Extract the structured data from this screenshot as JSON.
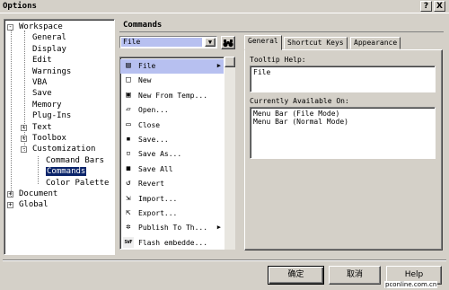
{
  "window": {
    "title": "Options",
    "help_button": "?",
    "close_button": "X"
  },
  "tree": {
    "items": [
      {
        "label": "Workspace",
        "expander": "-"
      },
      {
        "label": "General"
      },
      {
        "label": "Display"
      },
      {
        "label": "Edit"
      },
      {
        "label": "Warnings"
      },
      {
        "label": "VBA"
      },
      {
        "label": "Save"
      },
      {
        "label": "Memory"
      },
      {
        "label": "Plug-Ins"
      },
      {
        "label": "Text",
        "expander": "+"
      },
      {
        "label": "Toolbox",
        "expander": "+"
      },
      {
        "label": "Customization",
        "expander": "-"
      },
      {
        "label": "Command Bars"
      },
      {
        "label": "Commands",
        "selected": true
      },
      {
        "label": "Color Palette"
      },
      {
        "label": "Document",
        "expander": "+"
      },
      {
        "label": "Global",
        "expander": "+"
      }
    ]
  },
  "main": {
    "header": "Commands",
    "category_dropdown": {
      "value": "File",
      "arrow": "▼"
    },
    "find_button_icon": "binoculars-icon",
    "commands": [
      {
        "label": "File",
        "icon": "file-icon",
        "submenu": "▶",
        "selected": true
      },
      {
        "label": "New",
        "icon": "new-document-icon"
      },
      {
        "label": "New From Temp...",
        "icon": "new-from-template-icon"
      },
      {
        "label": "Open...",
        "icon": "open-folder-icon"
      },
      {
        "label": "Close",
        "icon": "close-document-icon"
      },
      {
        "label": "Save...",
        "icon": "save-icon"
      },
      {
        "label": "Save As...",
        "icon": "save-as-icon"
      },
      {
        "label": "Save All",
        "icon": "save-all-icon"
      },
      {
        "label": "Revert",
        "icon": "revert-icon"
      },
      {
        "label": "Import...",
        "icon": "import-icon"
      },
      {
        "label": "Export...",
        "icon": "export-icon"
      },
      {
        "label": "Publish To Th...",
        "icon": "publish-icon",
        "submenu": "▶"
      },
      {
        "label": "Flash embedde...",
        "icon": "swf-icon",
        "icon_text": "SWF"
      }
    ]
  },
  "tabs": [
    {
      "label": "General",
      "active": true
    },
    {
      "label": "Shortcut Keys"
    },
    {
      "label": "Appearance"
    }
  ],
  "general_tab": {
    "tooltip_label": "Tooltip Help:",
    "tooltip_value": "File",
    "available_label": "Currently Available On:",
    "available_value": "Menu Bar (File Mode)\nMenu Bar (Normal Mode)"
  },
  "buttons": {
    "ok": "确定",
    "cancel": "取消",
    "help": "Help"
  },
  "watermark": "pconline.com.cn",
  "colors": {
    "face": "#d4d0c8",
    "selection": "#b7c0f0"
  }
}
